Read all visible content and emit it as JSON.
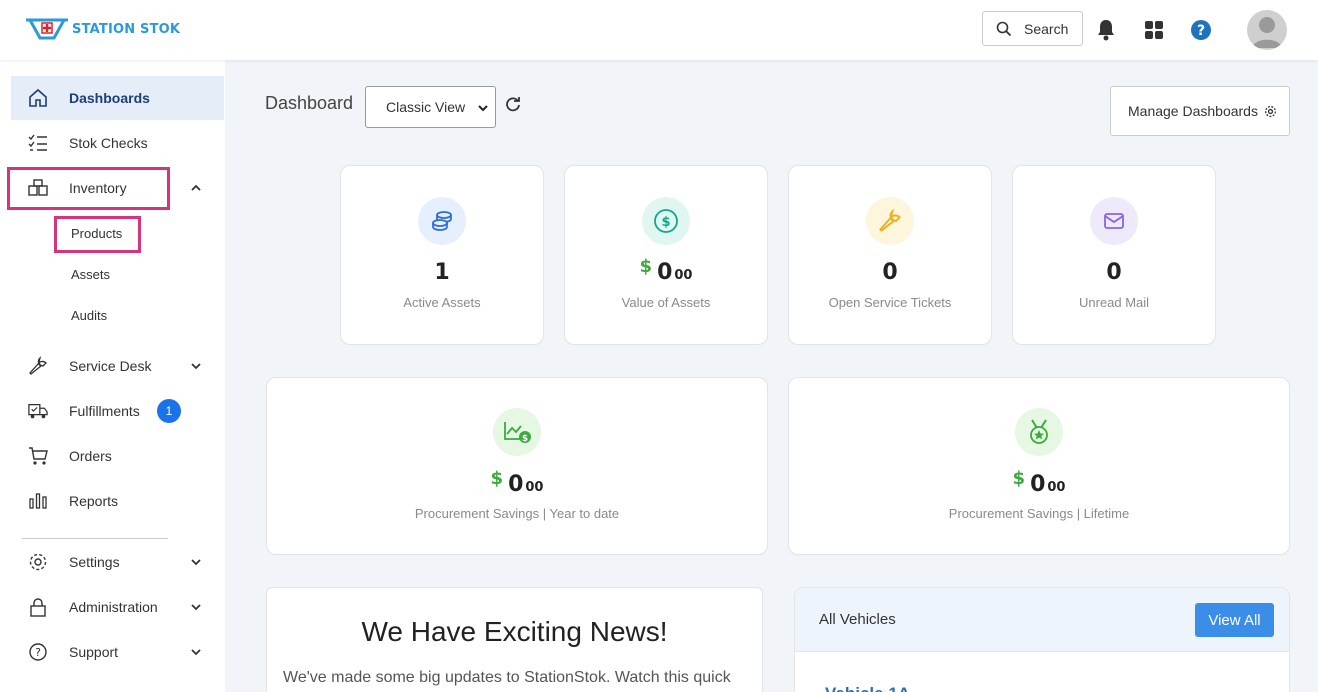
{
  "brand": {
    "logo_text": "STATION STOK"
  },
  "header": {
    "search_label": "Search"
  },
  "sidebar": {
    "items": [
      {
        "label": "Dashboards"
      },
      {
        "label": "Stok Checks"
      },
      {
        "label": "Inventory"
      },
      {
        "label": "Service Desk"
      },
      {
        "label": "Fulfillments",
        "badge": "1"
      },
      {
        "label": "Orders"
      },
      {
        "label": "Reports"
      },
      {
        "label": "Settings"
      },
      {
        "label": "Administration"
      },
      {
        "label": "Support"
      }
    ],
    "inventory_sub": [
      {
        "label": "Products"
      },
      {
        "label": "Assets"
      },
      {
        "label": "Audits"
      }
    ]
  },
  "main": {
    "title": "Dashboard",
    "view_select": "Classic View",
    "manage_label": "Manage Dashboards",
    "stats": [
      {
        "value": "1",
        "caption": "Active Assets"
      },
      {
        "currency": "$",
        "value": "0",
        "cents": "00",
        "caption": "Value of Assets"
      },
      {
        "value": "0",
        "caption": "Open Service Tickets"
      },
      {
        "value": "0",
        "caption": "Unread Mail"
      }
    ],
    "savings": [
      {
        "currency": "$",
        "value": "0",
        "cents": "00",
        "caption": "Procurement Savings | Year to date"
      },
      {
        "currency": "$",
        "value": "0",
        "cents": "00",
        "caption": "Procurement Savings | Lifetime"
      }
    ],
    "news": {
      "title": "We Have Exciting News!",
      "body": "We've made some big updates to StationStok. Watch this quick"
    },
    "vehicles": {
      "title": "All Vehicles",
      "view_all": "View All",
      "first_item": "Vehicle 1A"
    }
  },
  "colors": {
    "accent": "#1a73e8",
    "highlight": "#d6347c",
    "money_green": "#3caa3c",
    "active_nav_bg": "#e5edf8"
  }
}
